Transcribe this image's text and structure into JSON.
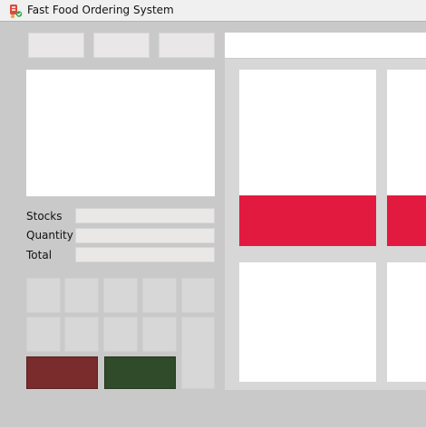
{
  "window": {
    "title": "Fast Food Ordering System",
    "icon": "food-order-icon"
  },
  "left_panel": {
    "top_buttons": [
      {
        "label": ""
      },
      {
        "label": ""
      },
      {
        "label": ""
      }
    ],
    "fields": {
      "stocks_label": "Stocks",
      "quantity_label": "Quantity",
      "total_label": "Total",
      "stocks_value": "",
      "quantity_value": "",
      "total_value": ""
    },
    "keypad": {
      "keys": [
        "",
        "",
        "",
        "",
        "",
        "",
        "",
        "",
        "",
        ""
      ],
      "tall_key": ""
    },
    "actions": {
      "left_color": "#7a2b2b",
      "right_color": "#2f4b2a"
    }
  },
  "right_panel": {
    "search_value": "",
    "card_band_color": "#e31a3f",
    "cards": [
      {
        "label": ""
      },
      {
        "label": ""
      },
      {
        "label": ""
      },
      {
        "label": ""
      }
    ]
  }
}
